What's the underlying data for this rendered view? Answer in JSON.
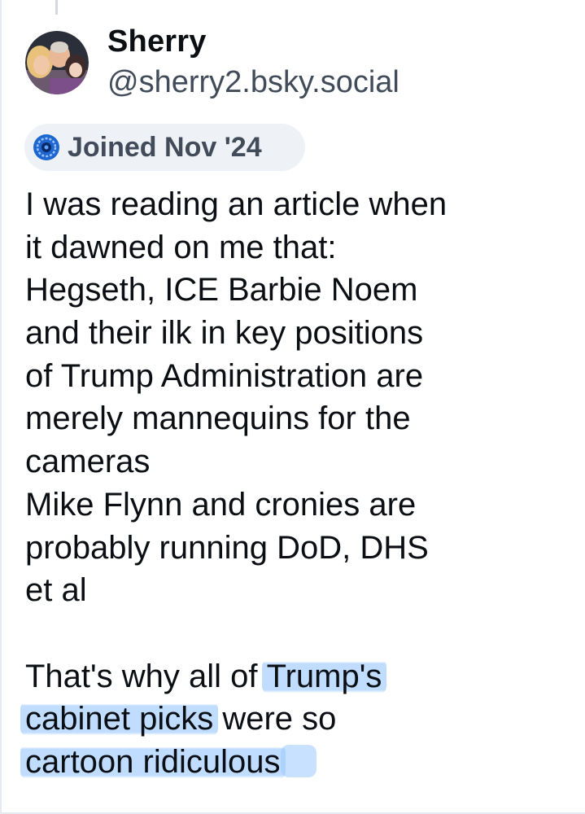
{
  "post": {
    "author": {
      "display_name": "Sherry",
      "handle": "@sherry2.bsky.social",
      "avatar_icon": "avatar-photo"
    },
    "badge": {
      "icon": "bluesky-joined-icon",
      "text": "Joined Nov '24"
    },
    "text_lines": [
      "I was reading an article when",
      "it dawned on me that:",
      "Hegseth, ICE Barbie Noem",
      "and their ilk in key positions",
      "of Trump Administration are",
      "merely mannequins for the",
      "cameras",
      "Mike Flynn and cronies are",
      "probably running DoD, DHS",
      "et al",
      "",
      "That's why all of ",
      "Trump's",
      "cabinet picks",
      " were so",
      "cartoon ridiculous"
    ],
    "highlight_color": "#9ac8ff"
  }
}
